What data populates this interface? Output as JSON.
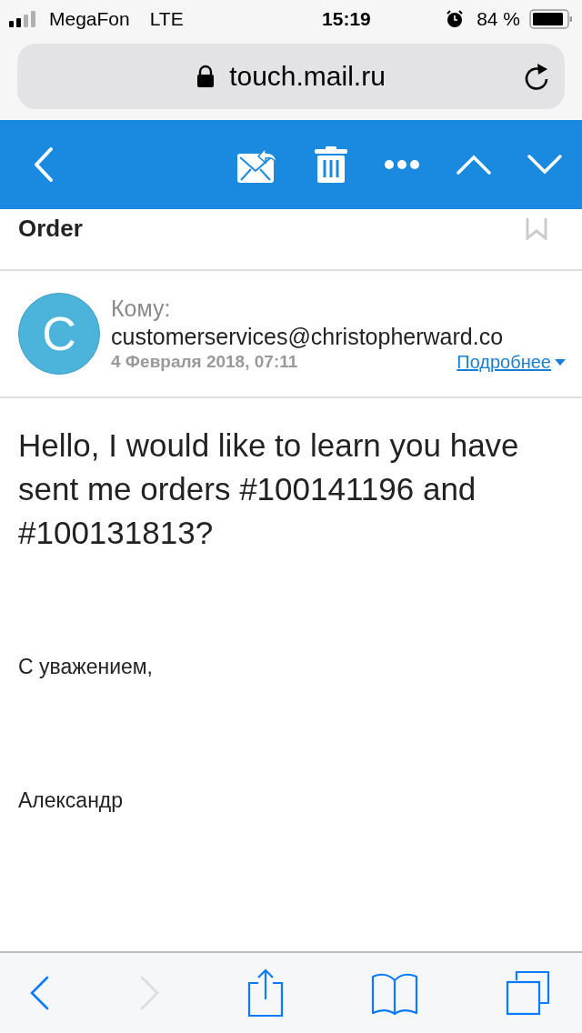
{
  "status_bar": {
    "carrier": "MegaFon",
    "network": "LTE",
    "time": "15:19",
    "battery": "84 %"
  },
  "address_bar": {
    "url": "touch.mail.ru"
  },
  "subject": "Order",
  "message": {
    "avatar_letter": "C",
    "to_label": "Кому:",
    "to": "customerservices@christopherward.co",
    "date": "4 Февраля 2018, 07:11",
    "details_link": "Подробнее"
  },
  "body": [
    {
      "kind": "text",
      "text": "Hello, I would like to learn you have sent me orders #100141196 and #100131813?"
    },
    {
      "kind": "small",
      "text": "С уважением,"
    },
    {
      "kind": "small",
      "text": "Александр"
    }
  ],
  "browser_toolbar": {
    "back_disabled": false,
    "forward_disabled": true
  }
}
